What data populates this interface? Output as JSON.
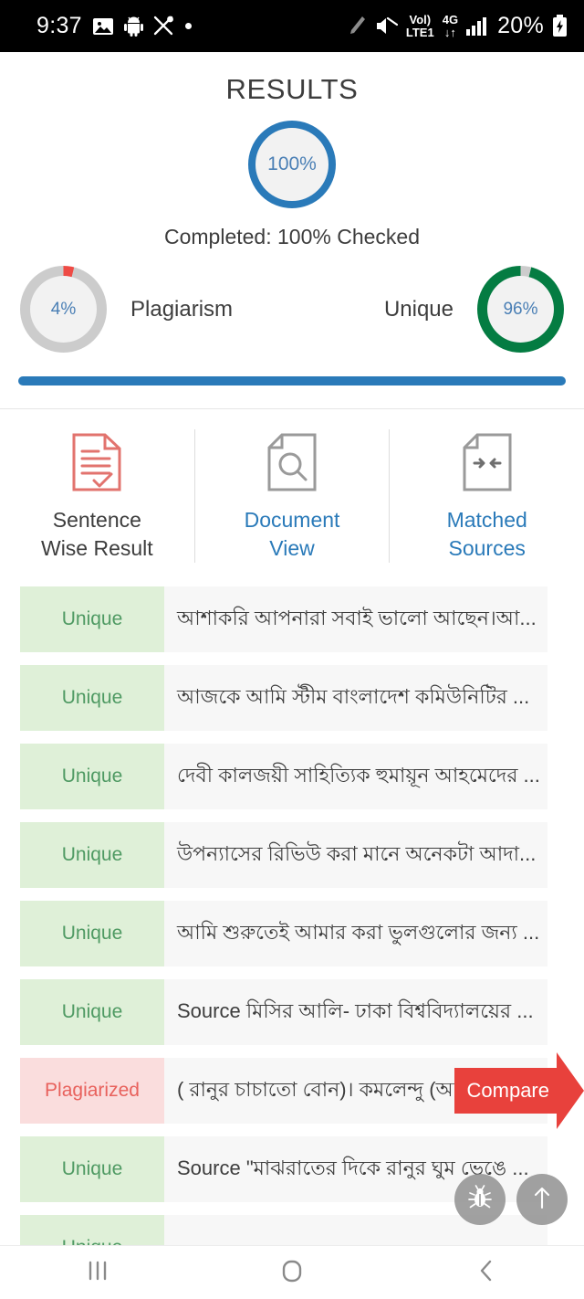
{
  "status_bar": {
    "time": "9:37",
    "left_icons": [
      "image-icon",
      "android-icon",
      "scissors-icon",
      "dot-icon"
    ],
    "right_icons": [
      "pencil-icon",
      "mute-icon"
    ],
    "volte_line1": "Vol)",
    "volte_line2": "LTE1",
    "network_line1": "4G",
    "network_line2": "↓↑",
    "signal_icon": "signal-bars-icon",
    "battery_percent": "20%",
    "battery_icon": "battery-charging-icon"
  },
  "header": {
    "title": "RESULTS",
    "overall_percent": "100%",
    "completed_text": "Completed: 100% Checked"
  },
  "stats": {
    "plagiarism": {
      "percent": "4%",
      "label": "Plagiarism",
      "value": 4,
      "color": "#ee4b45"
    },
    "unique": {
      "percent": "96%",
      "label": "Unique",
      "value": 96,
      "color": "#047c42"
    },
    "progress_bar_color": "#2a7ab9",
    "progress_bar_percent": 100
  },
  "tabs": [
    {
      "label": "Sentence\nWise Result",
      "line1": "Sentence",
      "line2": "Wise Result",
      "icon": "document-check-icon",
      "active": true
    },
    {
      "label": "Document\nView",
      "line1": "Document",
      "line2": "View",
      "icon": "document-search-icon",
      "active": false
    },
    {
      "label": "Matched\nSources",
      "line1": "Matched",
      "line2": "Sources",
      "icon": "document-arrows-icon",
      "active": false
    }
  ],
  "sentence_rows": [
    {
      "status": "Unique",
      "text": "আশাকরি আপনারা সবাই ভালো আছেন।আ...",
      "compare": null
    },
    {
      "status": "Unique",
      "text": "আজকে আমি স্টীম বাংলাদেশ কমিউনিটির ...",
      "compare": null
    },
    {
      "status": "Unique",
      "text": "দেবী কালজয়ী সাহিত্যিক হুমায়ূন আহমেদের ...",
      "compare": null
    },
    {
      "status": "Unique",
      "text": "উপন্যাসের রিভিউ করা মানে অনেকটা আদা...",
      "compare": null
    },
    {
      "status": "Unique",
      "text": "আমি শুরুতেই আমার করা ভুলগুলোর জন্য ...",
      "compare": null
    },
    {
      "status": "Unique",
      "text": "Source মিসির আলি- ঢাকা বিশ্ববিদ্যালয়ের ...",
      "compare": null
    },
    {
      "status": "Plagiarized",
      "text": "( রানুর চাচাতো বোন)। কমলেন্দু (আনি...",
      "compare": "Compare"
    },
    {
      "status": "Unique",
      "text": "Source \"মাঝরাতের দিকে রানুর ঘুম ভেঙে ...",
      "compare": null
    },
    {
      "status": "Unique",
      "text": "",
      "compare": null
    }
  ],
  "floating_buttons": [
    {
      "name": "bug-report-button",
      "icon": "bug-icon"
    },
    {
      "name": "scroll-to-top-button",
      "icon": "arrow-up-icon"
    }
  ],
  "nav_bar": [
    {
      "name": "recents-button",
      "icon": "recents-icon"
    },
    {
      "name": "home-button",
      "icon": "home-icon"
    },
    {
      "name": "back-button",
      "icon": "back-chevron-icon"
    }
  ]
}
